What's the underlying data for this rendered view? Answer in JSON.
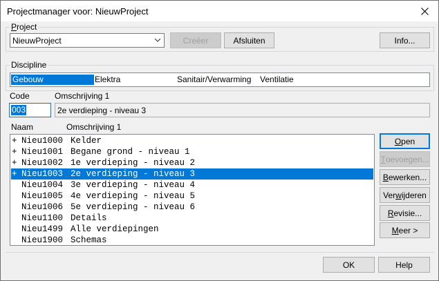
{
  "window": {
    "title": "Projectmanager voor: NieuwProject"
  },
  "project": {
    "legend_pre": "",
    "legend_u": "P",
    "legend_post": "roject",
    "combo_value": "NieuwProject",
    "create_label": "Creëer",
    "close_label": "Afsluiten",
    "info_label": "Info..."
  },
  "discipline": {
    "legend": "Discipline",
    "items": [
      "Gebouw",
      "Elektra",
      "Sanitair/Verwarming",
      "Ventilatie"
    ],
    "selected_index": 0
  },
  "code": {
    "label": "Code",
    "value": "003",
    "desc_label": "Omschrijving 1",
    "desc_value": "2e verdieping - niveau 3"
  },
  "list": {
    "col_naam": "Naam",
    "col_desc": "Omschrijving 1",
    "rows": [
      {
        "prefix": "+",
        "naam": "Nieu1000",
        "desc": "Kelder"
      },
      {
        "prefix": "+",
        "naam": "Nieu1001",
        "desc": "Begane grond - niveau 1"
      },
      {
        "prefix": "+",
        "naam": "Nieu1002",
        "desc": "1e verdieping - niveau 2"
      },
      {
        "prefix": "+",
        "naam": "Nieu1003",
        "desc": "2e verdieping - niveau 3"
      },
      {
        "prefix": "",
        "naam": "Nieu1004",
        "desc": "3e verdieping - niveau 4"
      },
      {
        "prefix": "",
        "naam": "Nieu1005",
        "desc": "4e verdieping - niveau 5"
      },
      {
        "prefix": "",
        "naam": "Nieu1006",
        "desc": "5e verdieping - niveau 6"
      },
      {
        "prefix": "",
        "naam": "Nieu1100",
        "desc": "Details"
      },
      {
        "prefix": "",
        "naam": "Nieu1499",
        "desc": "Alle verdiepingen"
      },
      {
        "prefix": "",
        "naam": "Nieu1900",
        "desc": "Schemas"
      }
    ],
    "selected_index": 3
  },
  "side_buttons": {
    "open": {
      "u": "O",
      "rest": "pen"
    },
    "toevoegen": {
      "u": "T",
      "rest": "oevoegen..."
    },
    "bewerken": {
      "u": "B",
      "rest": "ewerken..."
    },
    "verwijderen": {
      "pre": "Ver",
      "u": "w",
      "rest": "ijderen"
    },
    "revisie": {
      "u": "R",
      "rest": "evisie..."
    },
    "meer": {
      "u": "M",
      "rest": "eer >"
    }
  },
  "footer": {
    "ok_label": "OK",
    "help_label": "Help"
  },
  "icons": {
    "close": "close-icon",
    "dropdown": "chevron-down-icon"
  },
  "colors": {
    "selection": "#0078d7",
    "focus": "#0078d7"
  }
}
